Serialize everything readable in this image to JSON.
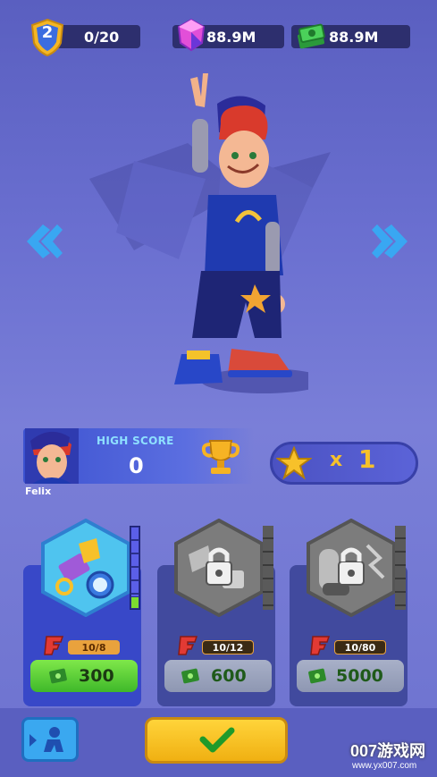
{
  "topbar": {
    "level": "2",
    "level_progress": "0/20",
    "gems": "88.9M",
    "cash": "88.9M"
  },
  "character": {
    "name": "Felix"
  },
  "high_score": {
    "label": "HIGH SCORE",
    "value": "0"
  },
  "stars": {
    "multiplier_prefix": "x",
    "multiplier_value": "1"
  },
  "upgrades": [
    {
      "name": "magnet-alarm-upgrade",
      "progress": "10/8",
      "price": "300",
      "locked": false,
      "level_fill": 1.0
    },
    {
      "name": "locked-upgrade-2",
      "progress": "10/12",
      "price": "600",
      "locked": true,
      "level_fill": 0.0
    },
    {
      "name": "locked-upgrade-3",
      "progress": "10/80",
      "price": "5000",
      "locked": true,
      "level_fill": 0.0
    }
  ],
  "watermark": {
    "line1": "007游戏网",
    "line2": "www.yx007.com"
  },
  "colors": {
    "accent_blue": "#3aa8f0",
    "green_button": "#52d23a",
    "confirm_yellow": "#f7c21b",
    "panel_blue": "#3b46c9",
    "locked_grey": "#8a8a8a"
  }
}
